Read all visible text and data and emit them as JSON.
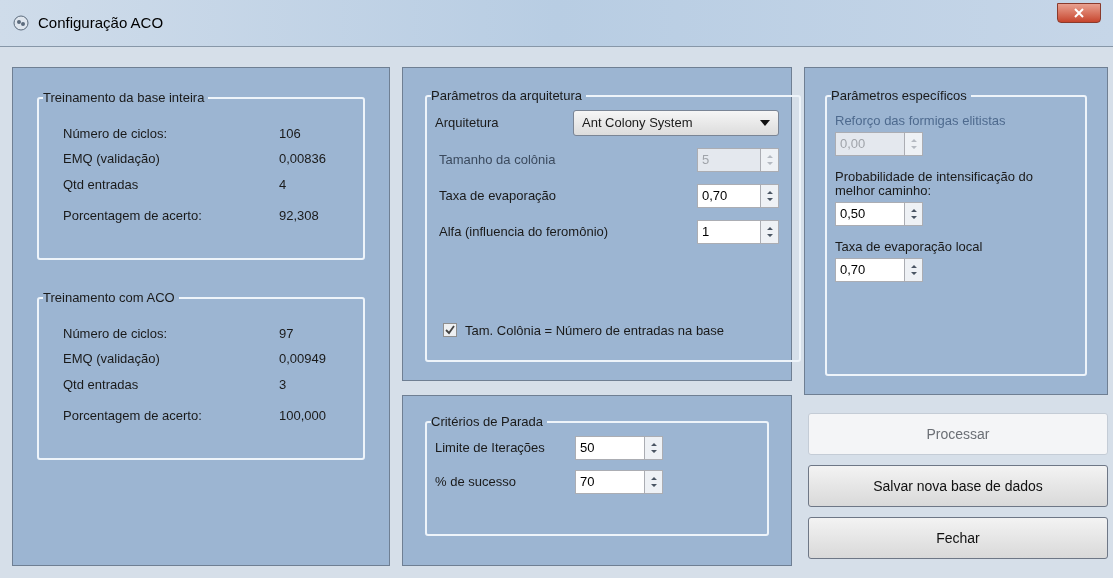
{
  "window": {
    "title": "Configuração ACO"
  },
  "results": [
    {
      "title": "Treinamento da base inteira",
      "rows": [
        {
          "label": "Número de ciclos:",
          "value": "106"
        },
        {
          "label": "EMQ (validação)",
          "value": "0,00836"
        },
        {
          "label": "Qtd entradas",
          "value": "4"
        },
        {
          "label": "Porcentagem de acerto:",
          "value": "92,308"
        }
      ]
    },
    {
      "title": "Treinamento com ACO",
      "rows": [
        {
          "label": "Número de ciclos:",
          "value": "97"
        },
        {
          "label": "EMQ (validação)",
          "value": "0,00949"
        },
        {
          "label": "Qtd entradas",
          "value": "3"
        },
        {
          "label": "Porcentagem de acerto:",
          "value": "100,000"
        }
      ]
    }
  ],
  "architecture": {
    "title": "Parâmetros da arquitetura",
    "select_label": "Arquitetura",
    "select_value": "Ant Colony System",
    "fields": [
      {
        "label": "Tamanho da colônia",
        "value": "5",
        "disabled": true
      },
      {
        "label": "Taxa de evaporação",
        "value": "0,70",
        "disabled": false
      },
      {
        "label": "Alfa (influencia do feromônio)",
        "value": "1",
        "disabled": false
      }
    ],
    "checkbox": {
      "label": "Tam. Colônia = Número de entradas na base",
      "checked": true
    }
  },
  "stopping": {
    "title": "Critérios de Parada",
    "fields": [
      {
        "label": "Limite de Iterações",
        "value": "50",
        "disabled": false
      },
      {
        "label": "% de sucesso",
        "value": "70",
        "disabled": false
      }
    ]
  },
  "specific": {
    "title": "Parâmetros específicos",
    "fields": [
      {
        "label": "Reforço das formigas elitistas",
        "value": "0,00",
        "disabled": true
      },
      {
        "label": "Probabilidade de intensificação do melhor caminho:",
        "value": "0,50",
        "disabled": false
      },
      {
        "label": "Taxa de evaporação local",
        "value": "0,70",
        "disabled": false
      }
    ]
  },
  "buttons": [
    {
      "label": "Processar",
      "disabled": true
    },
    {
      "label": "Salvar nova base de dados",
      "disabled": false
    },
    {
      "label": "Fechar",
      "disabled": false
    }
  ]
}
